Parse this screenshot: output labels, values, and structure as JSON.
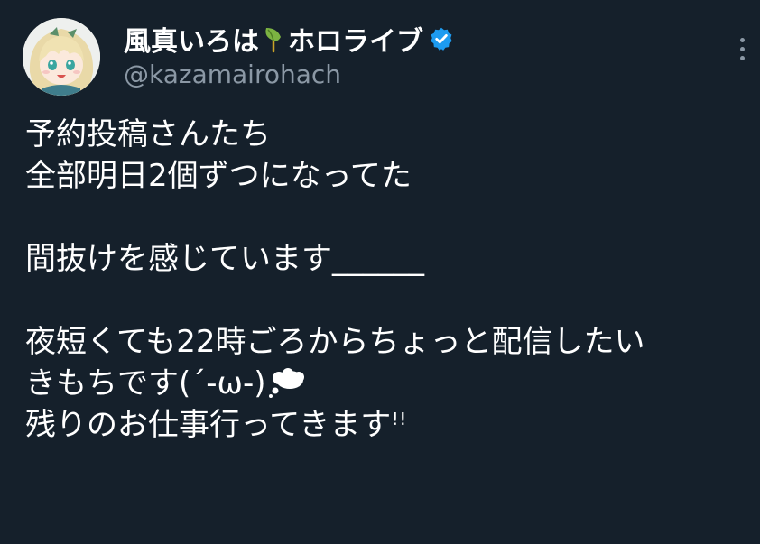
{
  "user": {
    "display_name": "風真いろは",
    "display_name_suffix": "ホロライブ",
    "handle": "@kazamairohach",
    "verified": true
  },
  "icons": {
    "avatar": "character-avatar",
    "name_emoji": "leaf-icon",
    "verified": "verified-badge-icon",
    "more": "more-options-icon",
    "text_emoji": "thought-balloon-icon"
  },
  "colors": {
    "background": "#15202b",
    "text": "#ffffff",
    "secondary_text": "#8b98a5",
    "verified_blue": "#1d9bf0",
    "leaf_green": "#7cb342"
  },
  "tweet": {
    "lines": [
      "予約投稿さんたち",
      "全部明日2個ずつになってた",
      "",
      "間抜けを感じています______",
      "",
      "夜短くても22時ごろからちょっと配信したい",
      "きもちです(´-ω-)",
      "残りのお仕事行ってきますꜝꜝ"
    ]
  }
}
